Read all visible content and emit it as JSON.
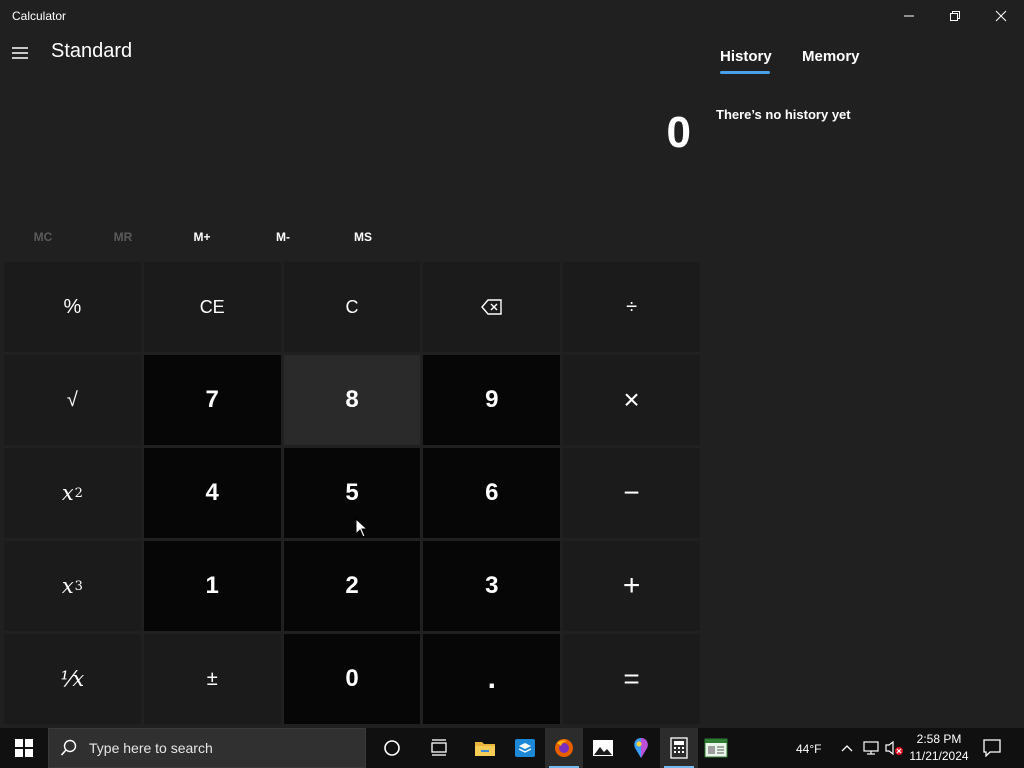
{
  "window": {
    "title": "Calculator",
    "minimize_icon": "minimize-icon",
    "restore_icon": "restore-icon",
    "close_icon": "close-icon"
  },
  "header": {
    "menu_icon": "hamburger-menu-icon",
    "mode": "Standard"
  },
  "display": {
    "value": "0"
  },
  "memory": {
    "buttons": [
      {
        "label": "MC",
        "enabled": false
      },
      {
        "label": "MR",
        "enabled": false
      },
      {
        "label": "M+",
        "enabled": true
      },
      {
        "label": "M-",
        "enabled": true
      },
      {
        "label": "MS",
        "enabled": true
      }
    ]
  },
  "keypad": {
    "rows": [
      [
        "%",
        "CE",
        "C",
        "backspace-icon",
        "÷"
      ],
      [
        "√",
        "7",
        "8",
        "9",
        "×"
      ],
      [
        "x²",
        "4",
        "5",
        "6",
        "−"
      ],
      [
        "x³",
        "1",
        "2",
        "3",
        "+"
      ],
      [
        "¹⁄x",
        "±",
        "0",
        ".",
        "="
      ]
    ],
    "labels": {
      "percent": "%",
      "ce": "CE",
      "c": "C",
      "divide": "÷",
      "sqrt": "√",
      "k7": "7",
      "k8": "8",
      "k9": "9",
      "multiply": "×",
      "sq_x": "x",
      "sq_exp": "2",
      "k4": "4",
      "k5": "5",
      "k6": "6",
      "minus": "−",
      "cube_x": "x",
      "cube_exp": "3",
      "k1": "1",
      "k2": "2",
      "k3": "3",
      "plus": "+",
      "reciprocal": "⅟x",
      "negate": "±",
      "k0": "0",
      "decimal": ".",
      "equals": "="
    }
  },
  "history_panel": {
    "tabs": [
      {
        "label": "History",
        "active": true
      },
      {
        "label": "Memory",
        "active": false
      }
    ],
    "empty_message": "There’s no history yet"
  },
  "taskbar": {
    "search_placeholder": "Type here to search",
    "weather": "44°F",
    "time": "2:58 PM",
    "date": "11/21/2024",
    "accent": "#76b9ed"
  },
  "colors": {
    "background": "#202020",
    "number_key": "#060606",
    "function_key": "#1b1b1b",
    "hovered_key": "#2a2a2a",
    "tab_accent": "#4aa0e6"
  }
}
